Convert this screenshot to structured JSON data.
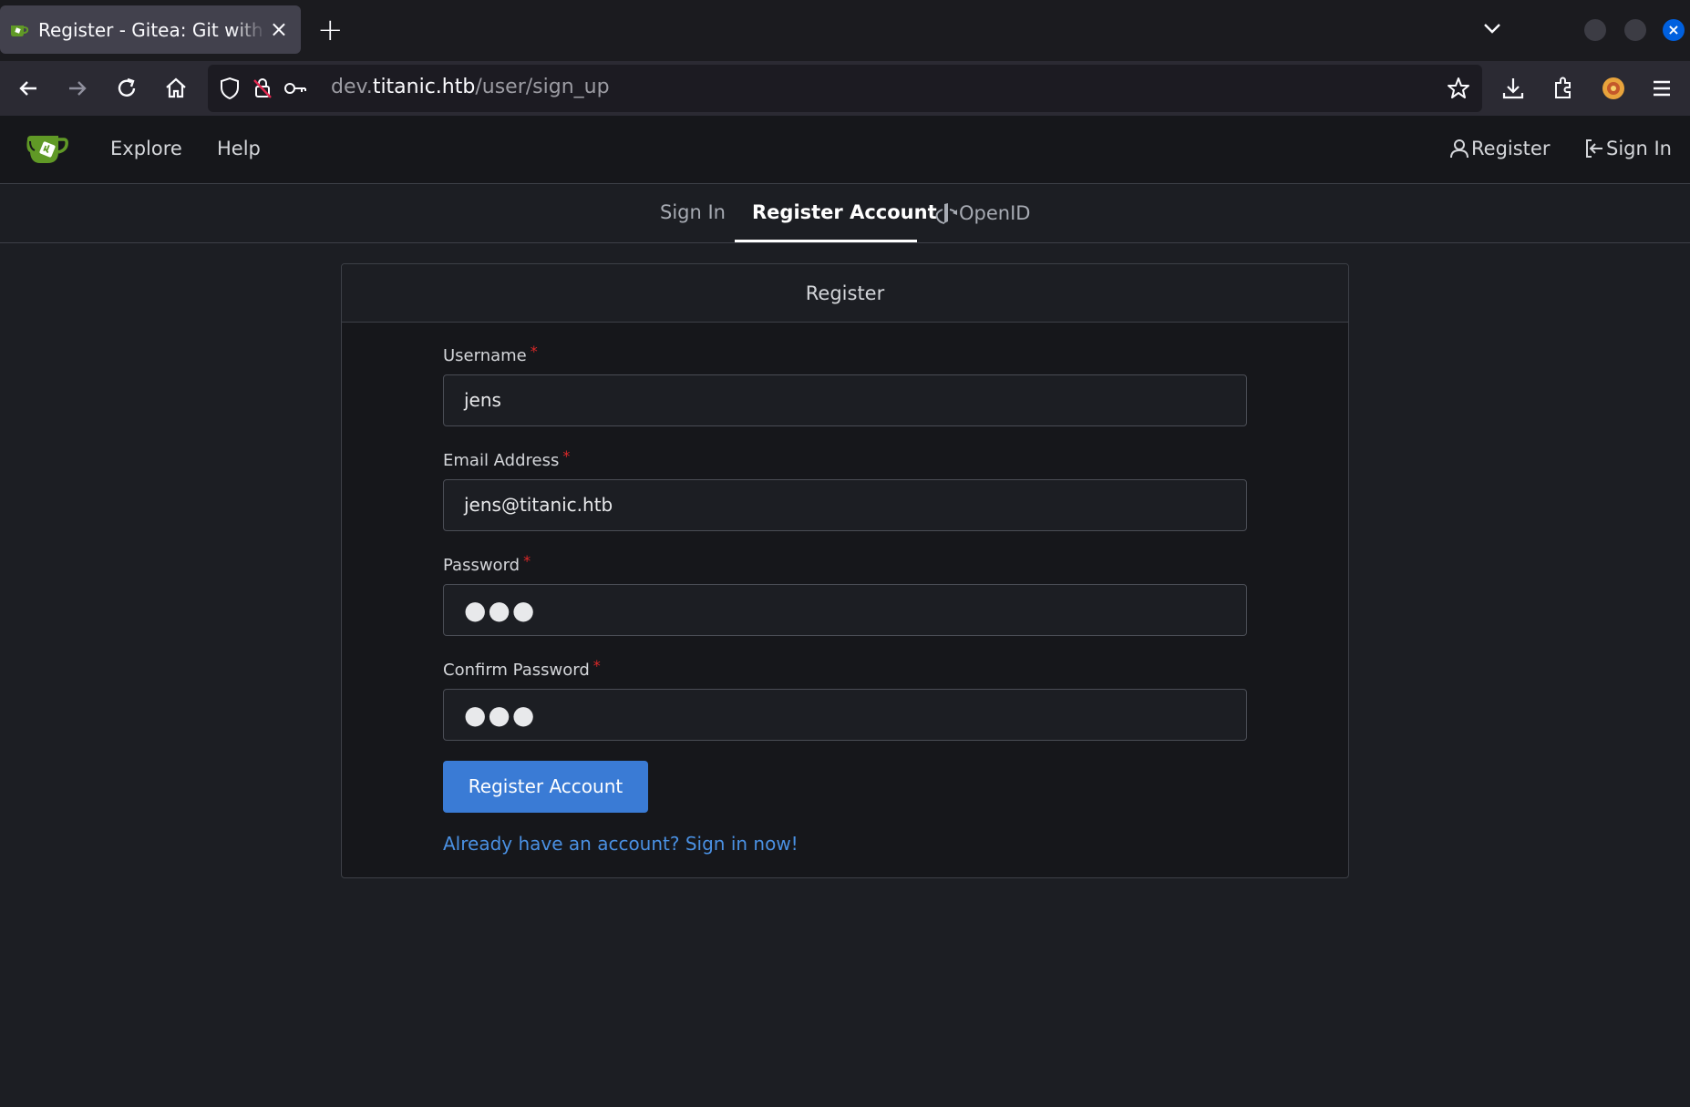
{
  "browser": {
    "tab_title": "Register - Gitea: Git with a cup of tea",
    "new_tab_symbol": "+",
    "close_symbol": "×",
    "url_prefix": "dev.",
    "url_host": "titanic.htb",
    "url_path": "/user/sign_up"
  },
  "header": {
    "nav": [
      {
        "label": "Explore"
      },
      {
        "label": "Help"
      }
    ],
    "register_label": "Register",
    "signin_label": "Sign In"
  },
  "tabs": {
    "signin": "Sign In",
    "register": "Register Account",
    "openid": "OpenID"
  },
  "form": {
    "title": "Register",
    "username": {
      "label": "Username",
      "value": "jens"
    },
    "email": {
      "label": "Email Address",
      "value": "jens@titanic.htb"
    },
    "password": {
      "label": "Password",
      "value": "●●●"
    },
    "confirm": {
      "label": "Confirm Password",
      "value": "●●●"
    },
    "required_mark": "*",
    "submit_label": "Register Account",
    "signin_link": "Already have an account? Sign in now!"
  },
  "colors": {
    "primary": "#3a7bd5",
    "link": "#4a90e2",
    "required": "#db2828",
    "logo_green": "#609926"
  },
  "icons": [
    "back-arrow-icon",
    "forward-arrow-icon",
    "reload-icon",
    "home-icon",
    "shield-icon",
    "insecure-lock-icon",
    "key-icon",
    "star-icon",
    "download-icon",
    "extensions-icon",
    "profile-icon",
    "hamburger-menu-icon",
    "user-icon",
    "sign-in-icon",
    "openid-icon",
    "gitea-logo-icon"
  ]
}
